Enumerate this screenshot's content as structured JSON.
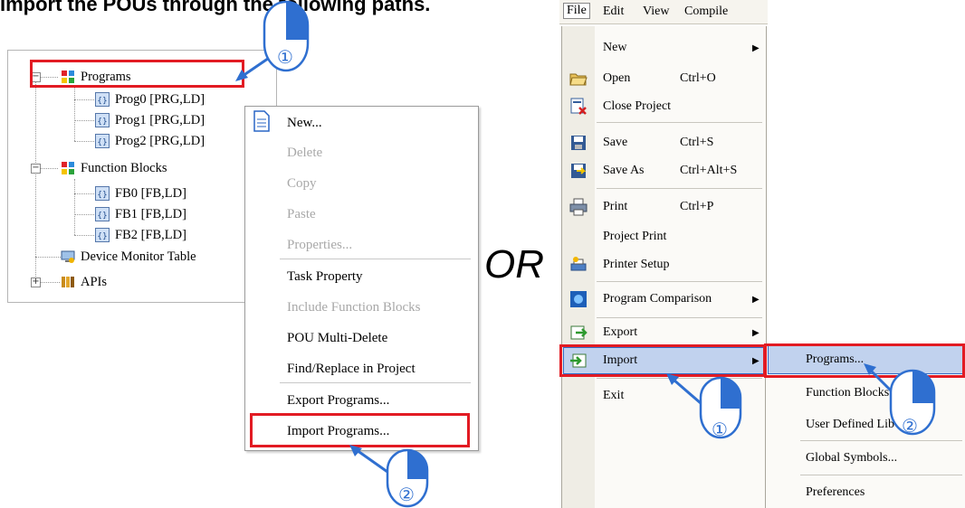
{
  "heading": "Import the POUs through the following paths.",
  "tree": {
    "items": [
      {
        "label": "Programs",
        "kind": "folder"
      },
      {
        "label": "Prog0 [PRG,LD]",
        "kind": "pou"
      },
      {
        "label": "Prog1 [PRG,LD]",
        "kind": "pou"
      },
      {
        "label": "Prog2 [PRG,LD]",
        "kind": "pou"
      },
      {
        "label": "Function Blocks",
        "kind": "folder"
      },
      {
        "label": "FB0 [FB,LD]",
        "kind": "pou"
      },
      {
        "label": "FB1 [FB,LD]",
        "kind": "pou"
      },
      {
        "label": "FB2 [FB,LD]",
        "kind": "pou"
      },
      {
        "label": "Device Monitor Table",
        "kind": "monitor"
      },
      {
        "label": "APIs",
        "kind": "api"
      }
    ],
    "expander_minus": "−",
    "expander_plus": "+"
  },
  "context_menu": {
    "items": [
      {
        "label": "New...",
        "enabled": true
      },
      {
        "label": "Delete",
        "enabled": false
      },
      {
        "label": "Copy",
        "enabled": false
      },
      {
        "label": "Paste",
        "enabled": false
      },
      {
        "label": "Properties...",
        "enabled": false
      },
      {
        "label": "Task Property",
        "enabled": true
      },
      {
        "label": "Include Function Blocks",
        "enabled": false
      },
      {
        "label": "POU Multi-Delete",
        "enabled": true
      },
      {
        "label": "Find/Replace in Project",
        "enabled": true
      },
      {
        "label": "Export Programs...",
        "enabled": true
      },
      {
        "label": "Import Programs...",
        "enabled": true
      }
    ]
  },
  "or_label": "OR",
  "menubar": {
    "items": [
      "File",
      "Edit",
      "View",
      "Compile"
    ]
  },
  "file_menu": {
    "items": [
      {
        "label": "New",
        "shortcut": "",
        "submenu": true,
        "icon": "none"
      },
      {
        "label": "Open",
        "shortcut": "Ctrl+O",
        "submenu": false,
        "icon": "open-folder-icon"
      },
      {
        "label": "Close Project",
        "shortcut": "",
        "submenu": false,
        "icon": "close-project-icon"
      },
      {
        "label": "Save",
        "shortcut": "Ctrl+S",
        "submenu": false,
        "icon": "floppy-icon"
      },
      {
        "label": "Save As",
        "shortcut": "Ctrl+Alt+S",
        "submenu": false,
        "icon": "save-as-icon"
      },
      {
        "label": "Print",
        "shortcut": "Ctrl+P",
        "submenu": false,
        "icon": "printer-icon"
      },
      {
        "label": "Project Print",
        "shortcut": "",
        "submenu": false,
        "icon": "none"
      },
      {
        "label": "Printer Setup",
        "shortcut": "",
        "submenu": false,
        "icon": "printer-setup-icon"
      },
      {
        "label": "Program Comparison",
        "shortcut": "",
        "submenu": true,
        "icon": "compare-icon"
      },
      {
        "label": "Export",
        "shortcut": "",
        "submenu": true,
        "icon": "export-icon"
      },
      {
        "label": "Import",
        "shortcut": "",
        "submenu": true,
        "icon": "import-icon"
      },
      {
        "label": "Exit",
        "shortcut": "",
        "submenu": false,
        "icon": "none"
      }
    ]
  },
  "import_submenu": {
    "items": [
      "Programs...",
      "Function Blocks",
      "User Defined Lib",
      "Global Symbols...",
      "Preferences"
    ]
  },
  "callouts": {
    "step1": "①",
    "step2": "②"
  },
  "colors": {
    "highlight_red": "#e21b23",
    "callout_blue": "#2f6fd0",
    "menu_highlight": "#c1d2ee"
  }
}
